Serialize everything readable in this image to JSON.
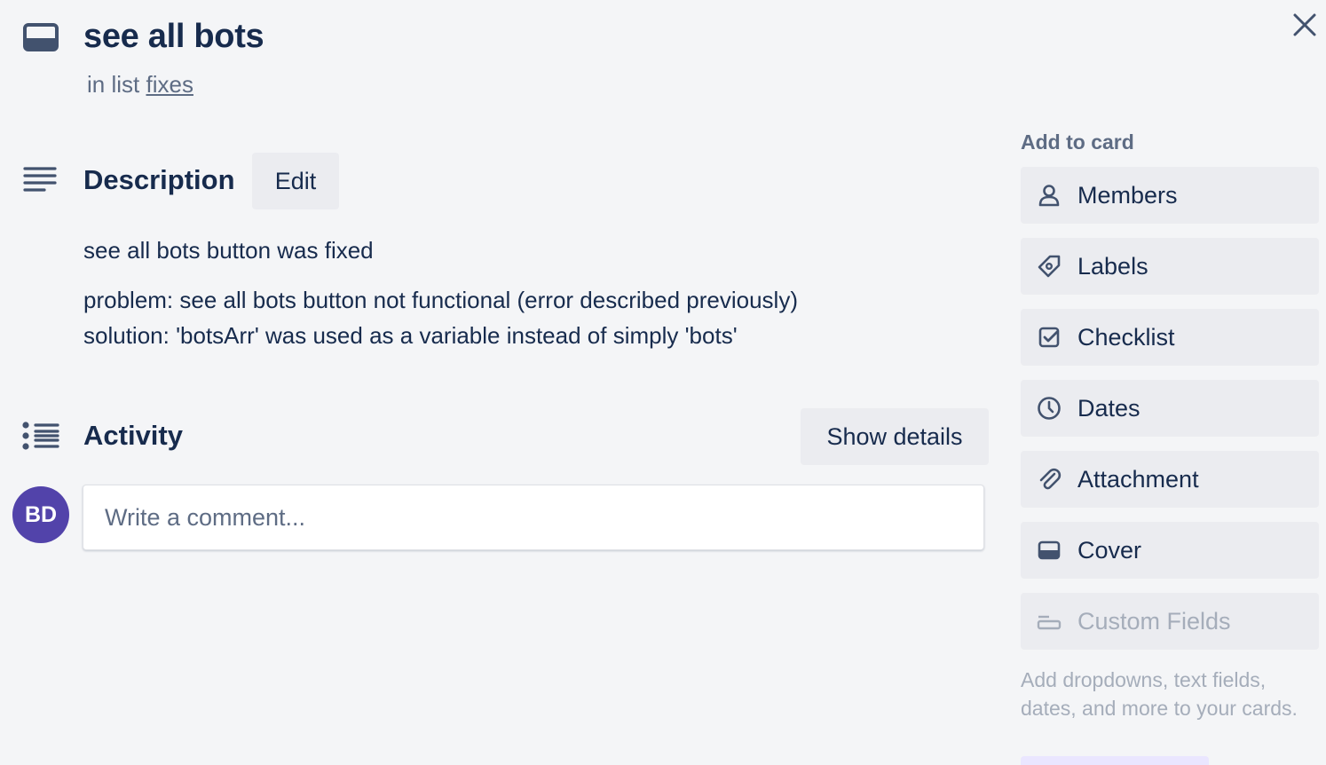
{
  "card": {
    "title": "see all bots",
    "in_list_prefix": "in list",
    "list_name": "fixes"
  },
  "description": {
    "heading": "Description",
    "edit_label": "Edit",
    "line1": "see all bots button was fixed",
    "line2": "problem: see all bots button not functional (error described previously)",
    "line3": "solution: 'botsArr' was used as a variable instead of simply 'bots'"
  },
  "activity": {
    "heading": "Activity",
    "show_details_label": "Show details",
    "avatar_initials": "BD",
    "comment_placeholder": "Write a comment..."
  },
  "sidebar": {
    "heading": "Add to card",
    "items": [
      {
        "label": "Members",
        "icon": "person-icon"
      },
      {
        "label": "Labels",
        "icon": "tag-icon"
      },
      {
        "label": "Checklist",
        "icon": "checkbox-icon"
      },
      {
        "label": "Dates",
        "icon": "clock-icon"
      },
      {
        "label": "Attachment",
        "icon": "paperclip-icon"
      },
      {
        "label": "Cover",
        "icon": "cover-icon"
      },
      {
        "label": "Custom Fields",
        "icon": "custom-fields-icon"
      }
    ],
    "note": "Add dropdowns, text fields, dates, and more to your cards."
  },
  "colors": {
    "background": "#f4f5f7",
    "text": "#172b4d",
    "muted": "#5e6c84",
    "button": "#ebecf0",
    "avatar": "#5243aa"
  }
}
